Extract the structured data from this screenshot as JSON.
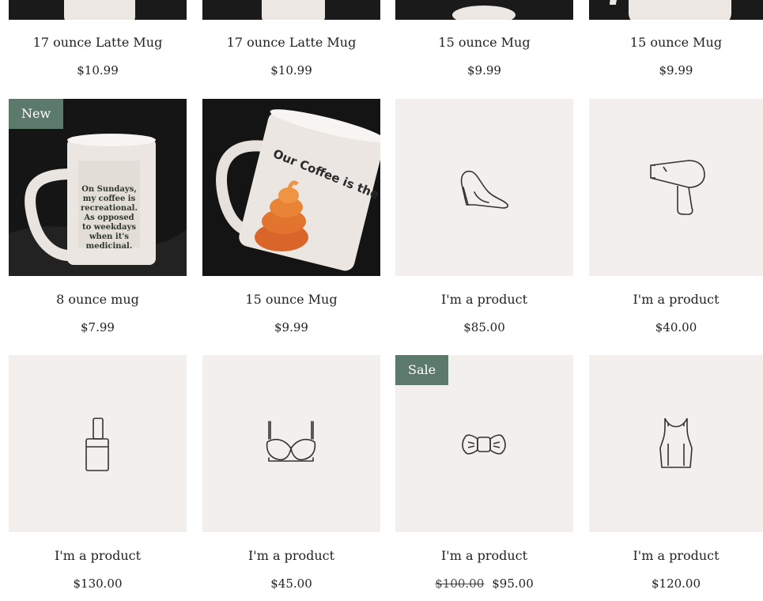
{
  "products": [
    {
      "name": "17 ounce Latte Mug",
      "price": "$10.99"
    },
    {
      "name": "17 ounce Latte Mug",
      "price": "$10.99"
    },
    {
      "name": "15 ounce Mug",
      "price": "$9.99"
    },
    {
      "name": "15 ounce Mug",
      "price": "$9.99"
    },
    {
      "name": "8 ounce mug",
      "price": "$7.99",
      "ribbon": "New",
      "mug_text": [
        "On Sundays,",
        "my coffee is",
        "recreational.",
        "As opposed",
        "to weekdays",
        "when it's",
        "medicinal."
      ]
    },
    {
      "name": "15 ounce Mug",
      "price": "$9.99",
      "mug_text": [
        "Our Coffee is the"
      ]
    },
    {
      "name": "I'm a product",
      "price": "$85.00",
      "icon": "high-heel-icon"
    },
    {
      "name": "I'm a product",
      "price": "$40.00",
      "icon": "hair-dryer-icon"
    },
    {
      "name": "I'm a product",
      "price": "$130.00",
      "icon": "perfume-bottle-icon"
    },
    {
      "name": "I'm a product",
      "price": "$45.00",
      "icon": "bra-icon"
    },
    {
      "name": "I'm a product",
      "price": "$95.00",
      "old_price": "$100.00",
      "ribbon": "Sale",
      "icon": "bow-tie-icon"
    },
    {
      "name": "I'm a product",
      "price": "$120.00",
      "icon": "tank-top-icon"
    }
  ],
  "colors": {
    "ribbon": "#5b7a6b",
    "placeholder_bg": "#f3efed",
    "photo_bg": "#151515"
  }
}
